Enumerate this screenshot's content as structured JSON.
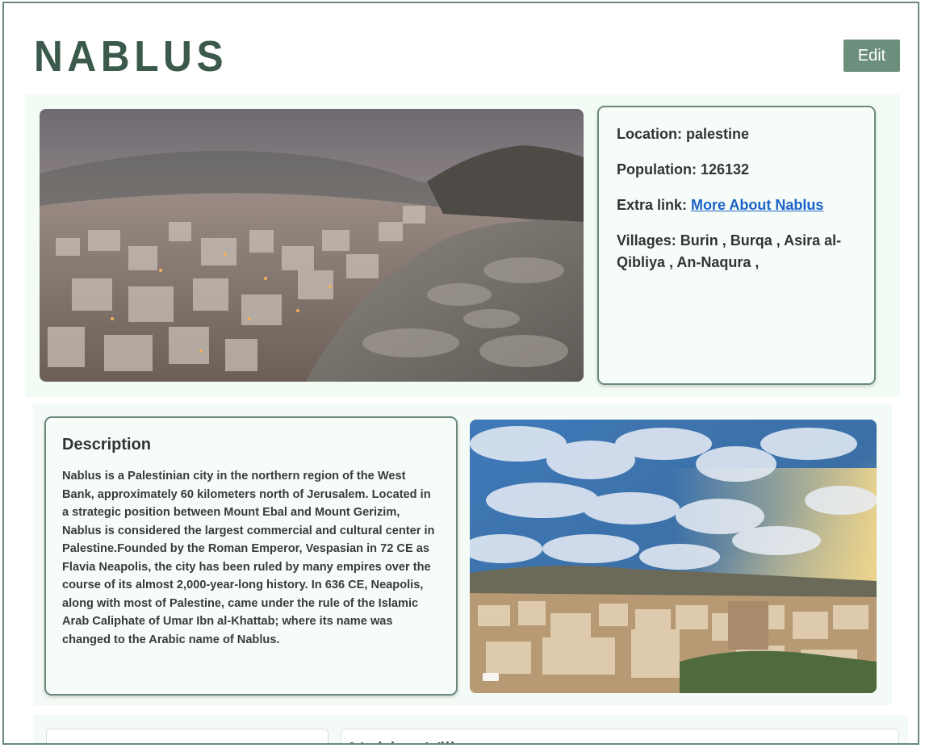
{
  "city": {
    "name": "NABLUS",
    "edit_label": "Edit"
  },
  "info": {
    "location_label": "Location:",
    "location_value": "palestine",
    "population_label": "Population:",
    "population_value": "126132",
    "extra_link_label": "Extra link:",
    "extra_link_text": "More About Nablus",
    "villages_label": "Villages:",
    "villages_value": "Burin , Burqa , Asira al-Qibliya , An-Naqura ,"
  },
  "description": {
    "title": "Description",
    "text": "Nablus is a Palestinian city in the northern region of the West Bank, approximately 60 kilometers north of Jerusalem. Located in a strategic position between Mount Ebal and Mount Gerizim, Nablus is considered the largest commercial and cultural center in Palestine.Founded by the Roman Emperor, Vespasian in 72 CE as Flavia Neapolis, the city has been ruled by many empires over the course of its almost 2,000-year-long history. In 636 CE, Neapolis, along with most of Palestine, came under the rule of the Islamic Arab Caliphate of Umar Ibn al-Khattab; where its name was changed to the Arabic name of Nablus."
  },
  "villages_section": {
    "title": "Nablus Villages"
  },
  "colors": {
    "accent": "#6b8f7c",
    "title": "#3c5a4c",
    "border": "#6b8a7d",
    "link": "#1a62c9",
    "panel": "#f3fbf5"
  }
}
